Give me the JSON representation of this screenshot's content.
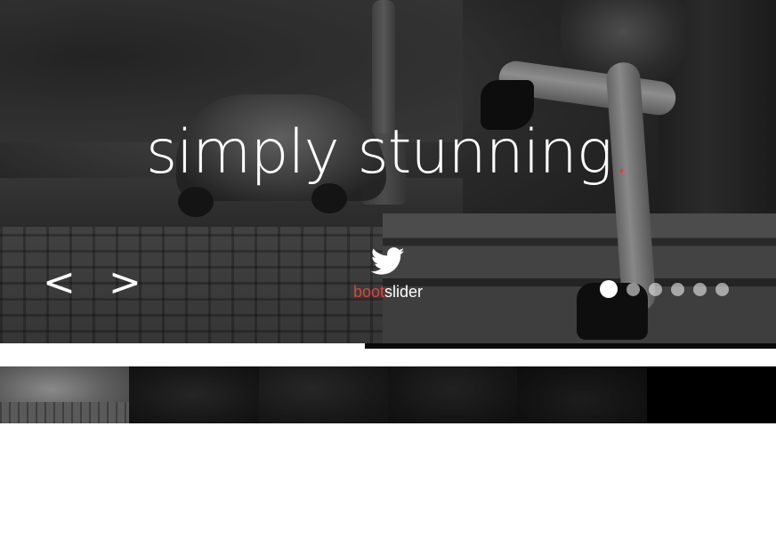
{
  "slider": {
    "headline": "simply stunning",
    "headline_dot": ".",
    "prev_arrow": "<",
    "next_arrow": ">",
    "brand": {
      "icon": "twitter-bird-icon",
      "text_accent": "boot",
      "text_main": "slider"
    },
    "accent_color": "#e0433a",
    "dots": {
      "count": 6,
      "active_index": 0
    },
    "progress": 0.47
  },
  "thumbnails": {
    "items": [
      {
        "label": "slide-1-thumbnail",
        "active": true
      },
      {
        "label": "slide-2-thumbnail",
        "active": false
      },
      {
        "label": "slide-3-thumbnail",
        "active": false
      },
      {
        "label": "slide-4-thumbnail",
        "active": false
      },
      {
        "label": "slide-5-thumbnail",
        "active": false
      },
      {
        "label": "slide-6-thumbnail",
        "active": false
      }
    ]
  }
}
